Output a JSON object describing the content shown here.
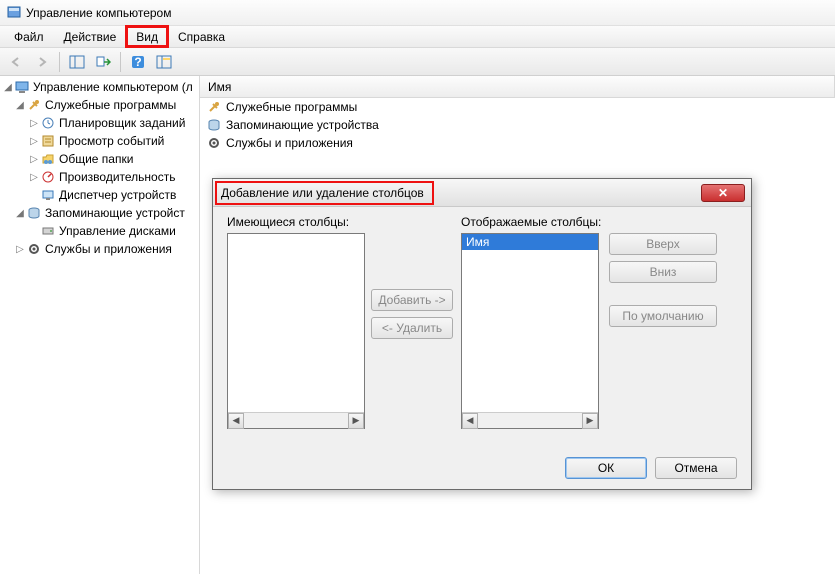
{
  "window": {
    "title": "Управление компьютером"
  },
  "menu": {
    "file": "Файл",
    "action": "Действие",
    "view": "Вид",
    "help": "Справка"
  },
  "tree": {
    "root": "Управление компьютером (л",
    "svc_programs": "Служебные программы",
    "scheduler": "Планировщик заданий",
    "event_viewer": "Просмотр событий",
    "shared_folders": "Общие папки",
    "performance": "Производительность",
    "device_mgr": "Диспетчер устройств",
    "storage": "Запоминающие устройст",
    "disk_mgmt": "Управление дисками",
    "services": "Службы и приложения"
  },
  "list": {
    "col_name": "Имя",
    "item1": "Служебные программы",
    "item2": "Запоминающие устройства",
    "item3": "Службы и приложения"
  },
  "dialog": {
    "title": "Добавление или удаление столбцов",
    "available_label": "Имеющиеся столбцы:",
    "displayed_label": "Отображаемые столбцы:",
    "displayed_item": "Имя",
    "add_btn": "Добавить ->",
    "remove_btn": "<- Удалить",
    "up_btn": "Вверх",
    "down_btn": "Вниз",
    "default_btn": "По умолчанию",
    "ok_btn": "ОК",
    "cancel_btn": "Отмена"
  }
}
